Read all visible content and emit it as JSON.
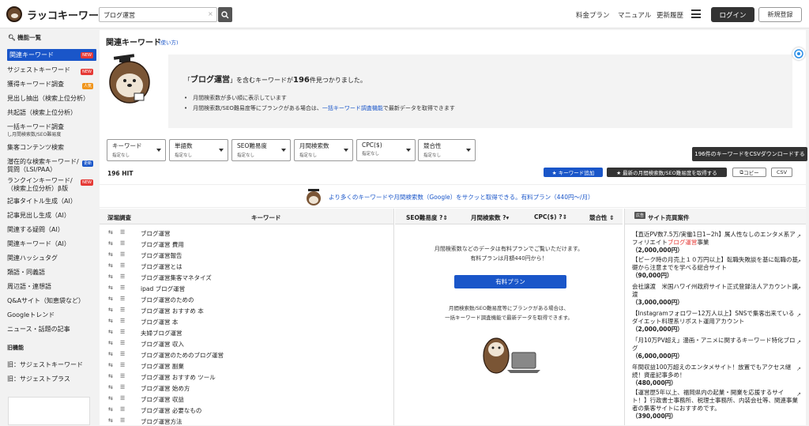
{
  "header": {
    "logo_text": "ラッコキーワード",
    "search_value": "ブログ運営",
    "search_clear": "×",
    "nav": [
      "料金プラン",
      "マニュアル",
      "更新履歴"
    ],
    "login": "ログイン",
    "signup": "新規登録"
  },
  "sidebar": {
    "heading": "機能一覧",
    "items": [
      {
        "label": "関連キーワード",
        "badge": "NEW"
      },
      {
        "label": "サジェストキーワード",
        "badge": "NEW"
      },
      {
        "label": "獲得キーワード調査",
        "badge": "人気"
      },
      {
        "label": "見出し抽出（検索上位分析）"
      },
      {
        "label": "共起語（検索上位分析）"
      },
      {
        "label": "一括キーワード調査",
        "sub": "し月間検索数/SEO難易度"
      },
      {
        "label": "集客コンテンツ検索"
      },
      {
        "label": "潜在的な検索キーワード/",
        "sub2": "質問（LSI/PAA）",
        "badge": "更新"
      },
      {
        "label": "ランクインキーワード/",
        "sub2": "（検索上位分析）β版",
        "badge": "NEW"
      },
      {
        "label": "記事タイトル生成（AI）"
      },
      {
        "label": "記事見出し生成（AI）"
      },
      {
        "label": "関連する疑問（AI）"
      },
      {
        "label": "関連キーワード（AI）"
      },
      {
        "label": "関連ハッシュタグ"
      },
      {
        "label": "類語・同義語"
      },
      {
        "label": "周辺語・連想語"
      },
      {
        "label": "Q&Aサイト（知恵袋など）"
      },
      {
        "label": "Googleトレンド"
      },
      {
        "label": "ニュース・話題の記事"
      }
    ],
    "old_heading": "旧機能",
    "old_items": [
      "旧：サジェストキーワード",
      "旧：サジェストプラス"
    ]
  },
  "main": {
    "title": "関連キーワード",
    "howto": "(使い方)",
    "result_pre": "「",
    "result_kw": "ブログ運営",
    "result_mid": "」を含むキーワードが",
    "result_count": "196",
    "result_post": "件見つかりました。",
    "bullet1": "月間検索数が多い順に表示しています",
    "bullet2_pre": "月間検索数/SEO難易度等にブランクがある場合は、",
    "bullet2_link": "一括キーワード調査機能",
    "bullet2_post": "で最新データを取得できます",
    "filters": [
      {
        "label": "キーワード",
        "value": "指定なし"
      },
      {
        "label": "単語数",
        "value": "指定なし"
      },
      {
        "label": "SEO難易度",
        "value": "指定なし"
      },
      {
        "label": "月間検索数",
        "value": "指定なし"
      },
      {
        "label": "CPC($)",
        "value": "指定なし"
      },
      {
        "label": "競合性",
        "value": "指定なし"
      }
    ],
    "tooltip": "196件のキーワードをCSVダウンロードする",
    "hit": "196 HIT",
    "btn_add": "★ キーワード追加",
    "btn_latest": "★ 最新の月間検索数/SEO難易度を取得する",
    "btn_copy": "コピー",
    "btn_csv": "CSV",
    "promo": "より多くのキーワードや月間検索数（Google）をサクッと取得できる。有料プラン（440円〜/月）",
    "col_deep": "深堀調査",
    "col_keyword": "キーワード",
    "col_seo": "SEO難易度",
    "col_volume": "月間検索数",
    "col_cpc": "CPC($)",
    "col_comp": "競合性",
    "col_ads": "サイト売買案件",
    "ad_label": "広告",
    "keywords": [
      "ブログ運営",
      "ブログ運営 費用",
      "ブログ運営報告",
      "ブログ運営とは",
      "ブログ運営集客マネタイズ",
      "ipad ブログ運営",
      "ブログ運営のための",
      "ブログ運営 おすすめ 本",
      "ブログ運営 本",
      "夫婦ブログ運営",
      "ブログ運営 収入",
      "ブログ運営のためのブログ運営",
      "ブログ運営 副業",
      "ブログ運営 おすすめ ツール",
      "ブログ運営 始め方",
      "ブログ運営 収益",
      "ブログ運営 必要なもの",
      "ブログ運営方法"
    ],
    "mid_text1": "月間検索数などのデータは有料プランでご覧いただけます。",
    "mid_text2": "有料プランは月額440円から！",
    "mid_btn": "有料プラン",
    "mid_text3": "月間検索数/SEO難易度等にブランクがある場合は、",
    "mid_text4": "一括キーワード調査機能で最新データを取得できます。",
    "ads": [
      {
        "pre": "【直近PV数7.5万/実働1日1~2h】属人性なしのエンタメ系アフィリエイト",
        "red": "ブログ運営",
        "post": "事業",
        "price": "（2,000,000円）"
      },
      {
        "pre": "【ピーク時の月売上１０万円以上】転職失敗談を基に転職の基礎から注意までを学べる総合サイト",
        "price": "（90,000円）"
      },
      {
        "pre": "会社譲渡　米国ハワイ州政府サイト正式登録法人アカウント譲渡",
        "price": "（3,000,000円）"
      },
      {
        "pre": "【Instagramフォロワー12万人以上】SNSで集客出来ているダイエット料理系リポスト運用アカウント",
        "price": "（2,000,000円）"
      },
      {
        "pre": "「月10万PV超え」漫画・アニメに関するキーワード特化ブログ",
        "price": "（6,000,000円）"
      },
      {
        "pre": "年間収益100万超えのエンタメサイト！放置でもアクセス継続！資産記事多め！",
        "price": "（480,000円）"
      },
      {
        "pre": "【運営歴5年以上、福岡県内の起業・開業を応援するサイト！】行政書士事務所、税理士事務所、内装会社等、関連事業者の集客サイトにおすすめです。",
        "price": "（390,000円）"
      }
    ]
  }
}
